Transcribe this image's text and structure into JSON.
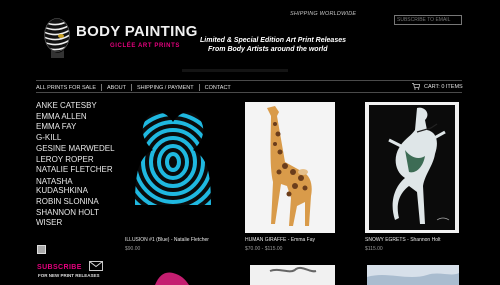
{
  "header": {
    "shipping": "SHIPPING WORLDWIDE",
    "subscribe_placeholder": "SUBSCRIBE TO EMAIL",
    "logo_title": "BODY PAINTING",
    "logo_subtitle": "GICLÉE ART PRINTS",
    "tagline_line1": "Limited & Special Edition Art Print Releases",
    "tagline_line2": "From Body Artists around the world"
  },
  "nav": {
    "items": [
      "ALL PRINTS FOR SALE",
      "ABOUT",
      "SHIPPING / PAYMENT",
      "CONTACT"
    ],
    "cart": "CART: 0 ITEMS"
  },
  "sidebar": {
    "artists": [
      "ANKE CATESBY",
      "EMMA ALLEN",
      "EMMA FAY",
      "G-KILL",
      "GESINE MARWEDEL",
      "LEROY ROPER",
      "NATALIE FLETCHER",
      "NATASHA KUDASHKINA",
      "ROBIN SLONINA",
      "SHANNON HOLT",
      "WISER"
    ],
    "subscribe_label": "SUBSCRIBE",
    "subscribe_sub": "FOR NEW PRINT RELEASES"
  },
  "products": [
    {
      "name": "ILLUSION #1 (Blue) - Natalie Fletcher",
      "price": "$90.00"
    },
    {
      "name": "HUMAN GIRAFFE - Emma Fay",
      "price": "$70.00 - $115.00"
    },
    {
      "name": "SNOWY EGRETS - Shannon Holt",
      "price": "$115.00"
    }
  ],
  "colors": {
    "accent": "#e6007e",
    "background": "#000000"
  }
}
